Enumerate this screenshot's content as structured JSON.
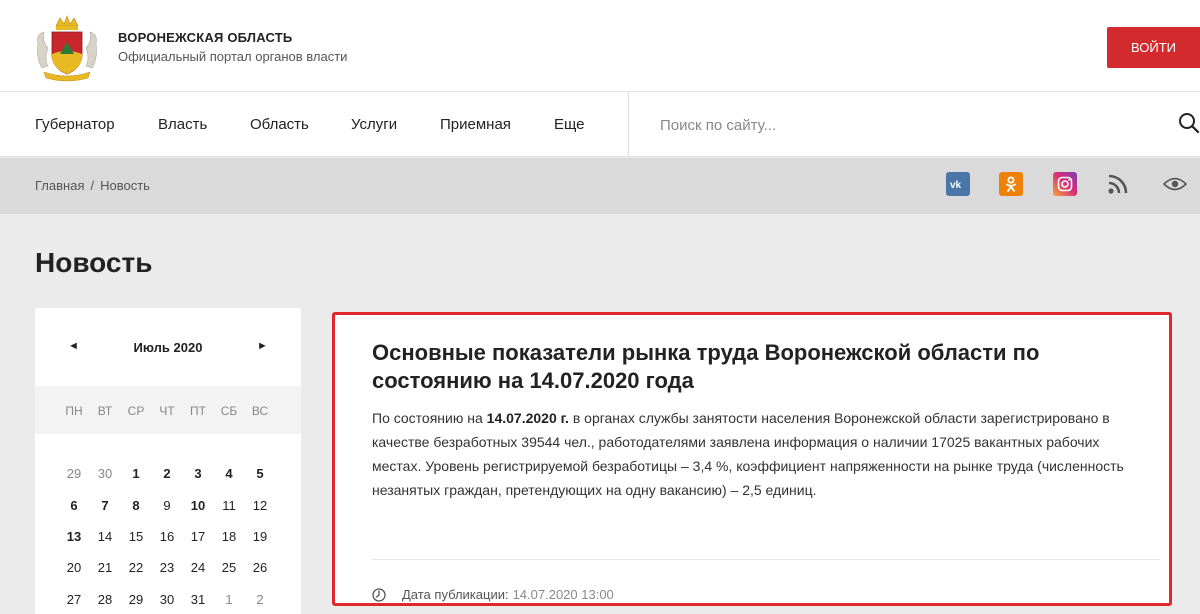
{
  "header": {
    "brand_title": "ВОРОНЕЖСКАЯ ОБЛАСТЬ",
    "brand_subtitle": "Официальный портал органов власти",
    "login_label": "ВОЙТИ",
    "accent_color": "#d22a2d"
  },
  "nav": {
    "items": [
      "Губернатор",
      "Власть",
      "Область",
      "Услуги",
      "Приемная",
      "Еще"
    ],
    "search_placeholder": "Поиск по сайту..."
  },
  "breadcrumb": {
    "items": [
      "Главная",
      "Новость"
    ],
    "separator": "/"
  },
  "social_icons": [
    "vk-icon",
    "odnoklassniki-icon",
    "instagram-icon",
    "rss-icon",
    "eye-icon"
  ],
  "page": {
    "title": "Новость"
  },
  "calendar": {
    "prev": "◄",
    "next": "►",
    "month_label": "Июль 2020",
    "weekdays": [
      "ПН",
      "ВТ",
      "СР",
      "ЧТ",
      "ПТ",
      "СБ",
      "ВС"
    ],
    "weeks": [
      [
        "29",
        "30",
        "1",
        "2",
        "3",
        "4",
        "5"
      ],
      [
        "6",
        "7",
        "8",
        "9",
        "10",
        "11",
        "12"
      ],
      [
        "13",
        "14",
        "15",
        "16",
        "17",
        "18",
        "19"
      ],
      [
        "20",
        "21",
        "22",
        "23",
        "24",
        "25",
        "26"
      ],
      [
        "27",
        "28",
        "29",
        "30",
        "31",
        "1",
        "2"
      ]
    ]
  },
  "article": {
    "title": "Основные показатели рынка труда Воронежской области по состоянию на 14.07.2020 года",
    "body_prefix": "По состоянию на ",
    "body_date": "14.07.2020 г.",
    "body_rest": " в органах службы занятости населения Воронежской области зарегистрировано в качестве безработных 39544 чел., работодателями заявлена информация о наличии 17025  вакантных  рабочих  местах. Уровень регистрируемой безработицы – 3,4 %, коэффициент напряженности на рынке труда (численность незанятых граждан, претендующих на одну вакансию) – 2,5 единиц.",
    "pub_label": "Дата публикации:",
    "pub_date": "14.07.2020 13:00",
    "highlight_color": "#e0282d"
  }
}
